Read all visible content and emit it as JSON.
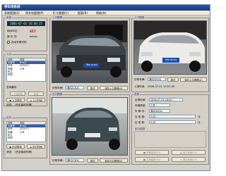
{
  "window": {
    "title": "停车场系统"
  },
  "menu": [
    {
      "label": "系统管理(S)"
    },
    {
      "label": "停车场管理(P)"
    },
    {
      "label": "IC卡管理(C)"
    },
    {
      "label": "报表(R)"
    },
    {
      "label": "帮助(H)"
    }
  ],
  "system_panel": {
    "legend": "系统",
    "datetime": "2006-07-01 16:00:25",
    "remaining_label": "剩余车位:",
    "remaining_value": "657",
    "operator_label": "操 作 员:",
    "operator_value": "admin",
    "auto_match_label": "自动车牌识别"
  },
  "entry_list": {
    "legend": "入口",
    "headers": [
      "名称",
      "内容"
    ],
    "rows": [
      {
        "name": "车牌号",
        "content": "B*W3"
      },
      {
        "name": "车号",
        "content": "SZ3473"
      },
      {
        "name": "车辆",
        "content": "小车"
      },
      {
        "name": "车主",
        "content": ""
      },
      {
        "name": "时间",
        "content": ""
      }
    ],
    "plate_query_label": "查询编号:",
    "buttons": [
      "入口抓拍",
      "开闸"
    ],
    "vehicle_label": "车辆",
    "status_label": "状态:",
    "status_value": "(完全接收车牌)",
    "side_buttons": [
      "入口抓拍",
      "入口开闸"
    ]
  },
  "exit_list": {
    "legend": "出口",
    "headers": [
      "名称",
      "内容"
    ],
    "rows": [
      {
        "name": "车牌号",
        "content": "B*W3"
      },
      {
        "name": "车号",
        "content": "SZ3473"
      },
      {
        "name": "车辆",
        "content": "小车"
      },
      {
        "name": "车主",
        "content": ""
      },
      {
        "name": "时间",
        "content": ""
      }
    ],
    "status_label": "状态:",
    "status_value": "(完全接收车牌)",
    "side_buttons": [
      "出口抓拍",
      "出口开闸"
    ]
  },
  "entry_camera": {
    "legend": "入口图像",
    "plate": "粤B·2C304",
    "plate_label": "识别车牌:",
    "plate_field": "粤B2C304",
    "buttons": [
      "重试",
      "保存入口图像(S)"
    ]
  },
  "entry_snapshot": {
    "legend": "入口图像",
    "plate": "粤B·2D534",
    "plate_label": "识别车牌:",
    "plate_field": "粤B2D534",
    "buttons": [
      "重试",
      "保存入口图像(S)"
    ],
    "time_label": "入场时间:",
    "time_value": "2006-07-01 15:51:00"
  },
  "exit_camera": {
    "legend": "出口图像",
    "plate_label": "识别车牌:",
    "plate_field": "粤B2C304",
    "buttons": [
      "重试",
      "保存出口图像(S)"
    ]
  },
  "info_panel": {
    "legend": "信息",
    "fields": [
      {
        "label": "出场时间:",
        "value": "2006-07-01 16:00"
      },
      {
        "label": "车辆类型:",
        "value": "小车"
      },
      {
        "label": "车 牌 号:",
        "value": "粤B2D534"
      },
      {
        "label": "应 收 费:",
        "value": "5.00",
        "unit": "元"
      },
      {
        "label": "实 收 费:",
        "value": "5.00",
        "unit": "元"
      }
    ],
    "exit_legend": "出口信息",
    "buttons": [
      "车辆信息(F2)",
      "出口开闸(F3)",
      "交班结帐(F4)",
      "退出系统(F5)"
    ]
  },
  "colors": {
    "title_bar": "#16397e",
    "lcd_text": "#9bf0ff",
    "remaining": "#cc0000",
    "selection": "#2f5fb3",
    "plate_bg": "#1b4fae"
  }
}
